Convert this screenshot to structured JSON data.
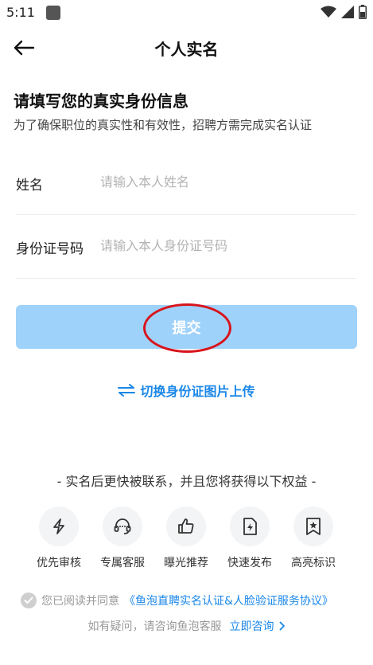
{
  "status_bar": {
    "time": "5:11"
  },
  "header": {
    "title": "个人实名"
  },
  "intro": {
    "heading": "请填写您的真实身份信息",
    "subheading": "为了确保职位的真实性和有效性，招聘方需完成实名认证"
  },
  "form": {
    "name_label": "姓名",
    "name_placeholder": "请输入本人姓名",
    "name_value": "",
    "id_label": "身份证号码",
    "id_placeholder": "请输入本人身份证号码",
    "id_value": ""
  },
  "submit_label": "提交",
  "switch_upload_label": "切换身份证图片上传",
  "benefits": {
    "title": "- 实名后更快被联系，并且您将获得以下权益 -",
    "items": [
      {
        "label": "优先审核",
        "icon": "lightning-icon"
      },
      {
        "label": "专属客服",
        "icon": "headset-icon"
      },
      {
        "label": "曝光推荐",
        "icon": "thumbs-up-icon"
      },
      {
        "label": "快速发布",
        "icon": "document-lightning-icon"
      },
      {
        "label": "高亮标识",
        "icon": "star-badge-icon"
      }
    ]
  },
  "agreement": {
    "prefix": "您已阅读并同意",
    "link": "《鱼泡直聘实名认证&人脸验证服务协议》"
  },
  "help": {
    "text": "如有疑问，请咨询鱼泡客服",
    "link": "立即咨询"
  },
  "colors": {
    "accent": "#1a87e8",
    "submit_disabled": "#9fd2fa",
    "annotation": "#d8141c"
  }
}
